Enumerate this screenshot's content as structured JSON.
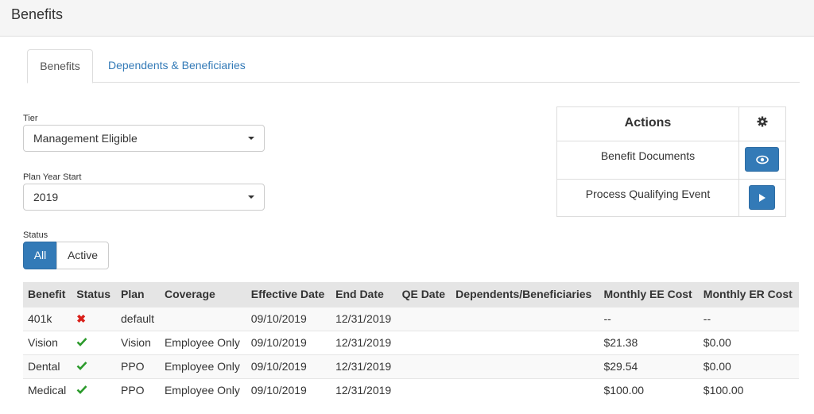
{
  "header": {
    "title": "Benefits"
  },
  "tabs": [
    {
      "label": "Benefits",
      "active": true
    },
    {
      "label": "Dependents & Beneficiaries",
      "active": false
    }
  ],
  "tier": {
    "label": "Tier",
    "value": "Management Eligible"
  },
  "plan_year": {
    "label": "Plan Year Start",
    "value": "2019"
  },
  "status_filter": {
    "label": "Status",
    "options": [
      "All",
      "Active"
    ],
    "selected": "All"
  },
  "actions": {
    "title": "Actions",
    "items": [
      {
        "label": "Benefit Documents",
        "icon": "eye-icon"
      },
      {
        "label": "Process Qualifying Event",
        "icon": "play-icon"
      }
    ]
  },
  "table": {
    "columns": [
      "Benefit",
      "Status",
      "Plan",
      "Coverage",
      "Effective Date",
      "End Date",
      "QE Date",
      "Dependents/Beneficiaries",
      "Monthly EE Cost",
      "Monthly ER Cost"
    ],
    "rows": [
      {
        "benefit": "401k",
        "status": "inactive",
        "plan": "default",
        "coverage": "",
        "effective": "09/10/2019",
        "end": "12/31/2019",
        "qe": "",
        "dependents": "",
        "ee_cost": "--",
        "er_cost": "--"
      },
      {
        "benefit": "Vision",
        "status": "active",
        "plan": "Vision",
        "coverage": "Employee Only",
        "effective": "09/10/2019",
        "end": "12/31/2019",
        "qe": "",
        "dependents": "",
        "ee_cost": "$21.38",
        "er_cost": "$0.00"
      },
      {
        "benefit": "Dental",
        "status": "active",
        "plan": "PPO",
        "coverage": "Employee Only",
        "effective": "09/10/2019",
        "end": "12/31/2019",
        "qe": "",
        "dependents": "",
        "ee_cost": "$29.54",
        "er_cost": "$0.00"
      },
      {
        "benefit": "Medical",
        "status": "active",
        "plan": "PPO",
        "coverage": "Employee Only",
        "effective": "09/10/2019",
        "end": "12/31/2019",
        "qe": "",
        "dependents": "",
        "ee_cost": "$100.00",
        "er_cost": "$100.00"
      }
    ]
  },
  "colors": {
    "primary": "#337ab7",
    "check": "#2b9a2b",
    "x": "#d9201a",
    "header_bg": "#f5f5f5",
    "table_header_bg": "#e5e5e5"
  }
}
